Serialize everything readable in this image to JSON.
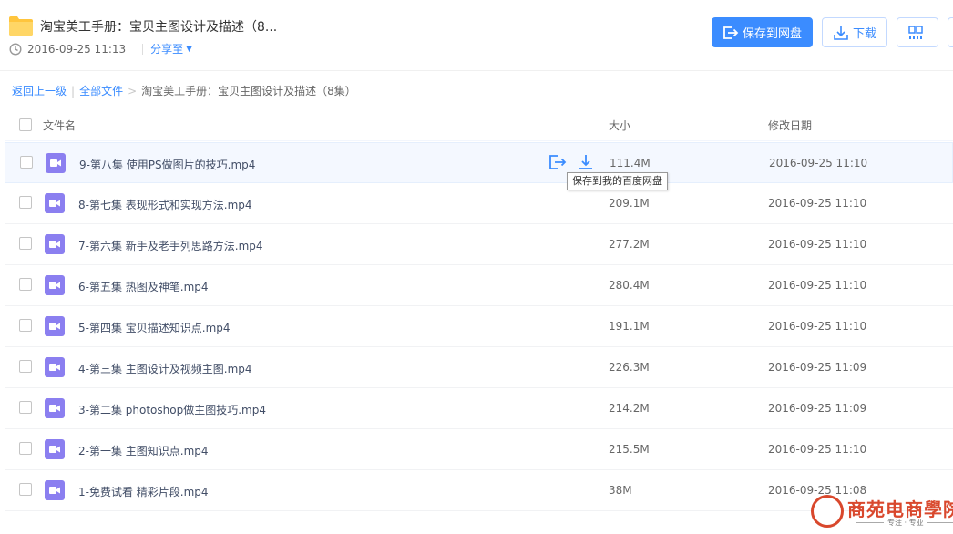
{
  "header": {
    "title": "淘宝美工手册：宝贝主图设计及描述（8...",
    "date": "2016-09-25 11:13",
    "share_to": "分享至",
    "save_button": "保存到网盘",
    "download_button": "下载"
  },
  "breadcrumb": {
    "back": "返回上一级",
    "all_files": "全部文件",
    "separator_1": "|",
    "separator_2": ">",
    "current": "淘宝美工手册：宝贝主图设计及描述（8集）"
  },
  "table": {
    "columns": {
      "name": "文件名",
      "size": "大小",
      "date": "修改日期"
    },
    "rows": [
      {
        "name": "9-第八集 使用PS做图片的技巧.mp4",
        "size": "111.4M",
        "date": "2016-09-25 11:10"
      },
      {
        "name": "8-第七集 表现形式和实现方法.mp4",
        "size": "209.1M",
        "date": "2016-09-25 11:10"
      },
      {
        "name": "7-第六集 新手及老手列思路方法.mp4",
        "size": "277.2M",
        "date": "2016-09-25 11:10"
      },
      {
        "name": "6-第五集 热图及神笔.mp4",
        "size": "280.4M",
        "date": "2016-09-25 11:10"
      },
      {
        "name": "5-第四集 宝贝描述知识点.mp4",
        "size": "191.1M",
        "date": "2016-09-25 11:10"
      },
      {
        "name": "4-第三集 主图设计及视频主图.mp4",
        "size": "226.3M",
        "date": "2016-09-25 11:09"
      },
      {
        "name": "3-第二集 photoshop做主图技巧.mp4",
        "size": "214.2M",
        "date": "2016-09-25 11:09"
      },
      {
        "name": "2-第一集 主图知识点.mp4",
        "size": "215.5M",
        "date": "2016-09-25 11:10"
      },
      {
        "name": "1-免费试看 精彩片段.mp4",
        "size": "38M",
        "date": "2016-09-25 11:08"
      }
    ]
  },
  "tooltip": "保存到我的百度网盘",
  "watermark": {
    "brand": "商苑电商學院",
    "tagline": "专注 · 专业"
  },
  "colors": {
    "primary": "#3b8cff",
    "video_icon": "#8b7ff0",
    "folder": "#ffc53d",
    "watermark": "#d9482d"
  },
  "icons": {
    "folder": "folder-icon",
    "clock": "clock-icon",
    "video": "video-file-icon",
    "save": "save-to-cloud-icon",
    "download": "download-icon",
    "qr": "qrcode-icon"
  }
}
